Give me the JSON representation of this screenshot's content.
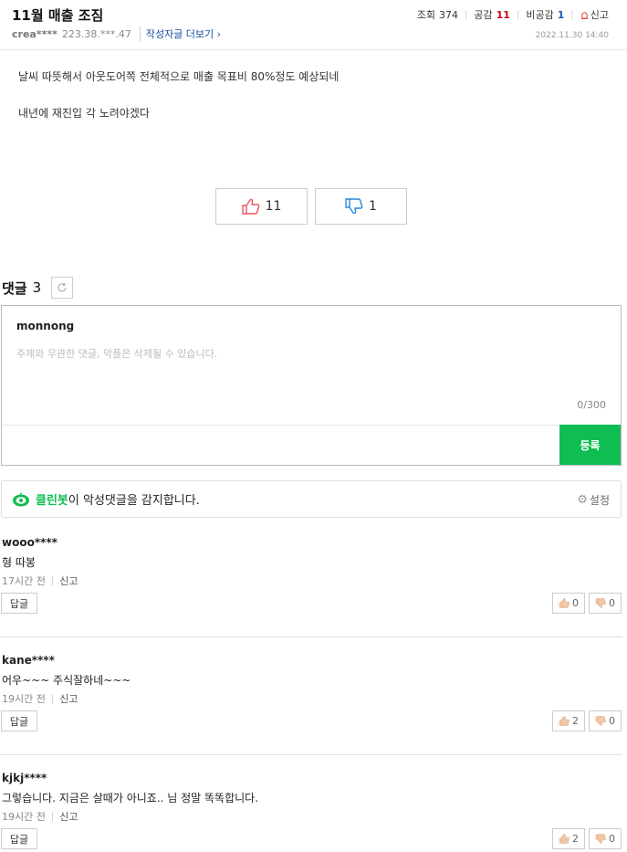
{
  "post": {
    "title": "11월 매출 조짐",
    "views_label": "조회",
    "views": "374",
    "likes_label": "공감",
    "likes": "11",
    "dislikes_label": "비공감",
    "dislikes": "1",
    "report_label": "신고",
    "author": "crea****",
    "ip": "223.38.***.47",
    "more_posts": "작성자글 더보기 ›",
    "date": "2022.11.30 14:40",
    "body": [
      "날씨 따뜻해서 아웃도어쪽 전체적으로 매출 목표비 80%정도 예상되네",
      "내년에 재진입 각 노려야겠다"
    ],
    "vote_up": "11",
    "vote_down": "1"
  },
  "comments_section": {
    "label": "댓글",
    "count": "3",
    "writer": "monnong",
    "placeholder": "주제와 무관한 댓글, 악플은 삭제될 수 있습니다.",
    "counter": "0/300",
    "submit": "등록",
    "cleanbot_name": "클린봇",
    "cleanbot_desc": "이 악성댓글을 감지합니다.",
    "settings": "설정"
  },
  "comments": [
    {
      "nick": "wooo****",
      "text": "형 따봉",
      "time": "17시간 전",
      "report": "신고",
      "reply": "답글",
      "up": "0",
      "down": "0"
    },
    {
      "nick": "kane****",
      "text": "어우~~~ 주식잘하네~~~",
      "time": "19시간 전",
      "report": "신고",
      "reply": "답글",
      "up": "2",
      "down": "0"
    },
    {
      "nick": "kjkj****",
      "text": "그렇습니다. 지금은 살때가 아니죠.. 님 정말 똑똑합니다.",
      "time": "19시간 전",
      "report": "신고",
      "reply": "답글",
      "up": "2",
      "down": "0"
    }
  ],
  "colors": {
    "accent_green": "#0fbe53",
    "likes_red": "#d0021b",
    "dislikes_blue": "#1a5bb8"
  },
  "icons": [
    "siren-icon",
    "thumb-up-icon",
    "thumb-down-icon",
    "refresh-icon",
    "cleanbot-icon",
    "gear-icon"
  ]
}
